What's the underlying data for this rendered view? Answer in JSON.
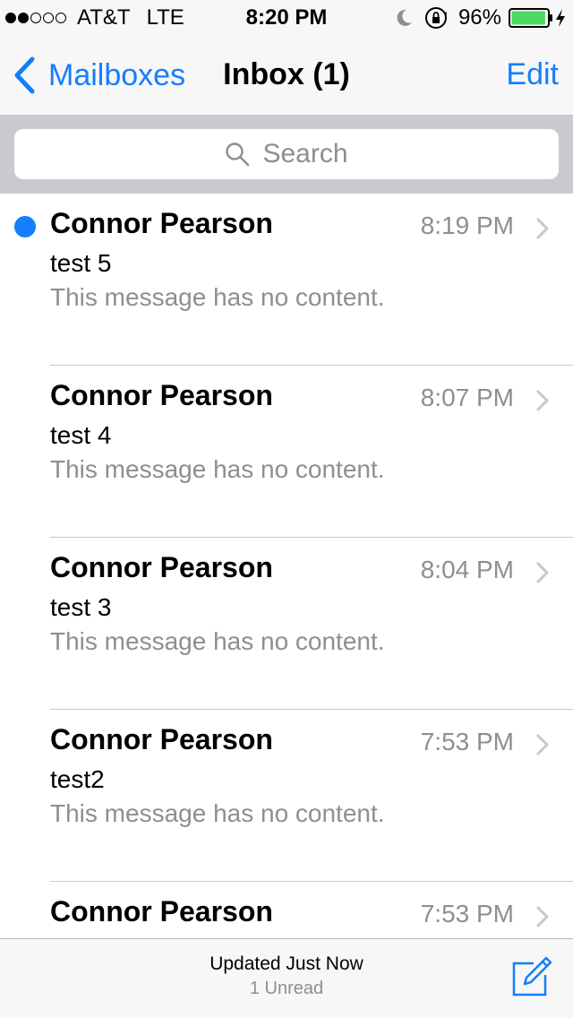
{
  "status_bar": {
    "carrier": "AT&T",
    "network": "LTE",
    "time": "8:20 PM",
    "battery_percent": "96%",
    "signal_bars_filled": 2,
    "signal_bars_total": 5,
    "battery_level": 0.96,
    "icons": [
      "moon-icon",
      "orientation-lock-icon",
      "battery-icon",
      "charging-bolt-icon"
    ]
  },
  "nav": {
    "back_label": "Mailboxes",
    "title": "Inbox (1)",
    "edit_label": "Edit"
  },
  "search": {
    "placeholder": "Search"
  },
  "messages": [
    {
      "sender": "Connor Pearson",
      "time": "8:19 PM",
      "subject": "test 5",
      "preview": "This message has no content.",
      "unread": true
    },
    {
      "sender": "Connor Pearson",
      "time": "8:07 PM",
      "subject": "test 4",
      "preview": "This message has no content.",
      "unread": false
    },
    {
      "sender": "Connor Pearson",
      "time": "8:04 PM",
      "subject": "test 3",
      "preview": "This message has no content.",
      "unread": false
    },
    {
      "sender": "Connor Pearson",
      "time": "7:53 PM",
      "subject": "test2",
      "preview": "This message has no content.",
      "unread": false
    },
    {
      "sender": "Connor Pearson",
      "time": "7:53 PM",
      "subject": "",
      "preview": "",
      "unread": false
    }
  ],
  "toolbar": {
    "updated_text": "Updated Just Now",
    "unread_count_text": "1 Unread"
  },
  "colors": {
    "accent": "#157efb",
    "secondary_text": "#8e8e93",
    "battery_green": "#4cd964",
    "search_bg": "#c9c9ce"
  }
}
